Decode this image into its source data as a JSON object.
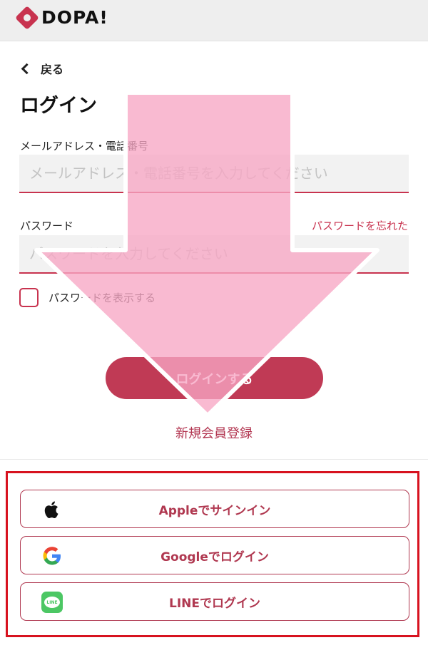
{
  "header": {
    "logo_text": "DOPA!"
  },
  "nav": {
    "back_label": "戻る"
  },
  "page": {
    "title": "ログイン"
  },
  "email": {
    "label": "メールアドレス・電話番号",
    "placeholder": "メールアドレス・電話番号を入力してください",
    "value": ""
  },
  "password": {
    "label": "パスワード",
    "placeholder": "パスワードを入力してください",
    "value": "",
    "forgot_link": "パスワードを忘れた"
  },
  "show_password": {
    "label": "パスワードを表示する",
    "checked": false
  },
  "actions": {
    "login_label": "ログインする",
    "register_label": "新規会員登録"
  },
  "social": [
    {
      "label": "Appleでサインイン",
      "icon": "apple-icon"
    },
    {
      "label": "Googleでログイン",
      "icon": "google-icon"
    },
    {
      "label": "LINEでログイン",
      "icon": "line-icon",
      "icon_text": "LINE"
    }
  ],
  "colors": {
    "accent": "#c8334f",
    "button": "#c03a55",
    "highlight_box": "#d7121f",
    "line_green": "#4cc764",
    "overlay_pink": "#f7a6c4"
  }
}
